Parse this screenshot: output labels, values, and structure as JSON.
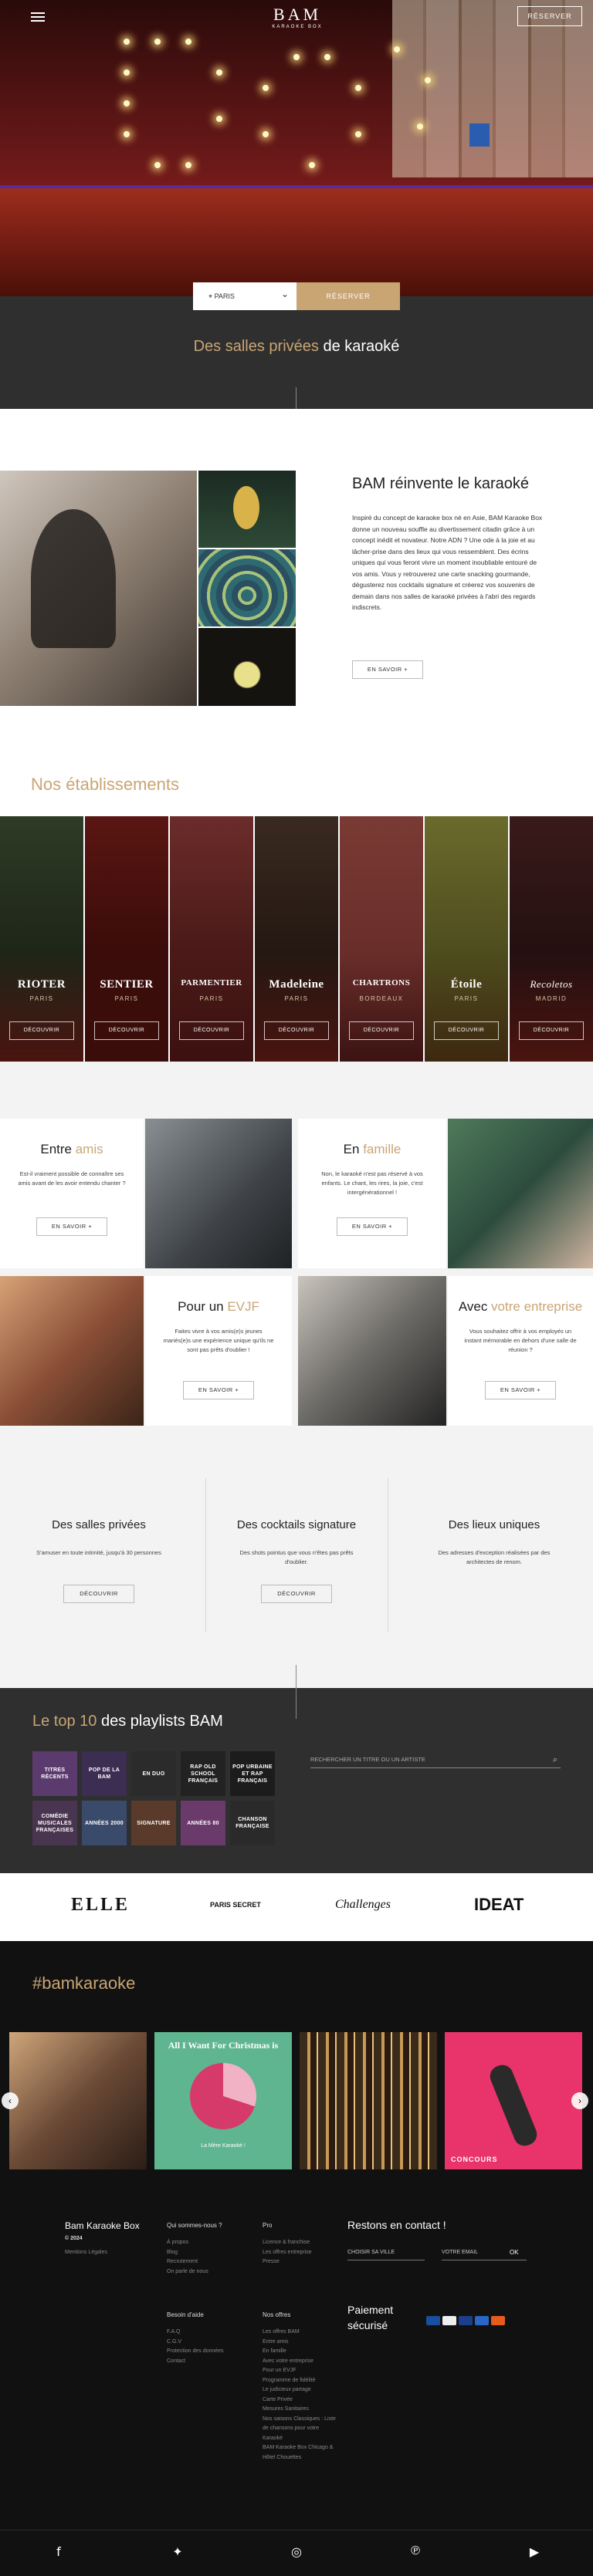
{
  "header": {
    "logo": "BAM",
    "logo_sub": "KARAOKE BOX",
    "reserve_label": "RÉSERVER"
  },
  "booking": {
    "city": "PARIS",
    "submit_label": "RÉSERVER"
  },
  "salles": {
    "title_gold": "Des salles privées",
    "title_white": " de karaoké"
  },
  "reinvente": {
    "title": "BAM réinvente le karaoké",
    "text": "Inspiré du concept de karaoke box né en Asie, BAM Karaoke Box donne un nouveau souffle au divertissement citadin grâce à un concept inédit et novateur. Notre ADN ? Une ode à la joie et au lâcher-prise dans des lieux qui vous ressemblent. Des écrins uniques qui vous feront vivre un moment inoubliable entouré de vos amis. Vous y retrouverez une carte snacking gourmande, dégusterez nos cocktails signature et créerez vos souvenirs de demain dans nos salles de karaoké privées à l'abri des regards indiscrets.",
    "button": "EN SAVOIR +"
  },
  "etablissements": {
    "title": "Nos établissements",
    "button": "DÉCOUVRIR",
    "items": [
      {
        "name": "RIOTER",
        "city": "PARIS"
      },
      {
        "name": "SENTIER",
        "city": "PARIS"
      },
      {
        "name": "PARMENTIER",
        "city": "PARIS"
      },
      {
        "name": "Madeleine",
        "city": "PARIS"
      },
      {
        "name": "CHARTRONS",
        "city": "BORDEAUX"
      },
      {
        "name": "Étoile",
        "city": "PARIS"
      },
      {
        "name": "Recoletos",
        "city": "MADRID"
      }
    ]
  },
  "occasions": {
    "button": "EN SAVOIR +",
    "amis": {
      "title_a": "Entre ",
      "title_b": "amis",
      "text": "Est-il vraiment possible de connaître ses amis avant de les avoir entendu chanter ?"
    },
    "famille": {
      "title_a": "En ",
      "title_b": "famille",
      "text": "Non, le karaoké n'est pas réservé à vos enfants. Le chant, les rires, la joie, c'est intergénérationnel !"
    },
    "evjf": {
      "title_a": "Pour un ",
      "title_b": "EVJF",
      "text": "Faites vivre à vos amis(e)s jeunes mariés(e)s une expérience unique qu'ils ne sont pas prêts d'oublier !"
    },
    "entreprise": {
      "title_a": "Avec ",
      "title_b": "votre entreprise",
      "text": "Vous souhaitez offrir à vos employés un instant mémorable en dehors d'une salle de réunion ?"
    }
  },
  "trio": [
    {
      "title": "Des salles privées",
      "text": "S'amuser en toute intimité, jusqu'à 30 personnes",
      "button": "DÉCOUVRIR"
    },
    {
      "title": "Des cocktails signature",
      "text": "Des shots pointus que vous n'êtes pas prêts d'oublier.",
      "button": "DÉCOUVRIR"
    },
    {
      "title": "Des lieux uniques",
      "text": "Des adresses d'exception réalisées par des architectes de renom.",
      "button": ""
    }
  ],
  "playlists": {
    "title_a": "Le top 10",
    "title_b": " des playlists BAM",
    "search_placeholder": "RECHERCHER UN TITRE OU UN ARTISTE",
    "tiles": [
      {
        "label": "TITRES RÉCENTS",
        "color": "#5b3a6e"
      },
      {
        "label": "POP DE LA BAM",
        "color": "#3c2d52"
      },
      {
        "label": "EN DUO",
        "color": "#2b2b2b"
      },
      {
        "label": "RAP OLD SCHOOL FRANÇAIS",
        "color": "#222222"
      },
      {
        "label": "POP URBAINE ET RAP FRANÇAIS",
        "color": "#1c1c1c"
      },
      {
        "label": "COMÉDIE MUSICALES FRANÇAISES",
        "color": "#4a3550"
      },
      {
        "label": "ANNÉES 2000",
        "color": "#3a4a6a"
      },
      {
        "label": "SIGNATURE",
        "color": "#5a3a2a"
      },
      {
        "label": "ANNÉES 80",
        "color": "#6a3a6a"
      },
      {
        "label": "CHANSON FRANÇAISE",
        "color": "#2a2a2a"
      }
    ]
  },
  "press": [
    "ELLE",
    "PARIS SECRET",
    "Challenges",
    "IDEAT"
  ],
  "instagram": {
    "title": "#bamkaraoke",
    "post2_title": "All I Want For Christmas is",
    "post2_bottom": "La Mère Karaoké !",
    "post4_label": "CONCOURS"
  },
  "footer": {
    "brand": "Bam Karaoke Box",
    "copyright": "© 2024",
    "legal": "Mentions Légales",
    "cols": [
      {
        "head": "Qui sommes-nous ?",
        "links": [
          "À propos",
          "Blog",
          "Recrutement",
          "On parle de nous"
        ]
      },
      {
        "head": "Pro",
        "links": [
          "Licence & franchise",
          "Les offres entreprise",
          "Presse"
        ]
      },
      {
        "head": "Besoin d'aide",
        "links": [
          "F.A.Q",
          "C.G.V",
          "Protection des données",
          "Contact"
        ]
      },
      {
        "head": "Nos offres",
        "links": [
          "Les offres BAM",
          "Entre amis",
          "En famille",
          "Avec votre entreprise",
          "Pour un EVJF",
          "Programme de fidélité",
          "Le judicieux partage",
          "Carte Privée",
          "Mesures Sanitaires",
          "Nos saisons Classiques : Liste de chansons pour votre Karaoké",
          "BAM Karaoke Box Chicago & Hôtel Chouettes"
        ]
      }
    ],
    "contact_title": "Restons en contact !",
    "city_select": "CHOISIR SA VILLE",
    "email_placeholder": "VOTRE EMAIL",
    "ok": "OK",
    "payment_title": "Paiement sécurisé"
  },
  "social": [
    "facebook-icon",
    "twitter-icon",
    "instagram-icon",
    "pinterest-icon",
    "youtube-icon"
  ]
}
